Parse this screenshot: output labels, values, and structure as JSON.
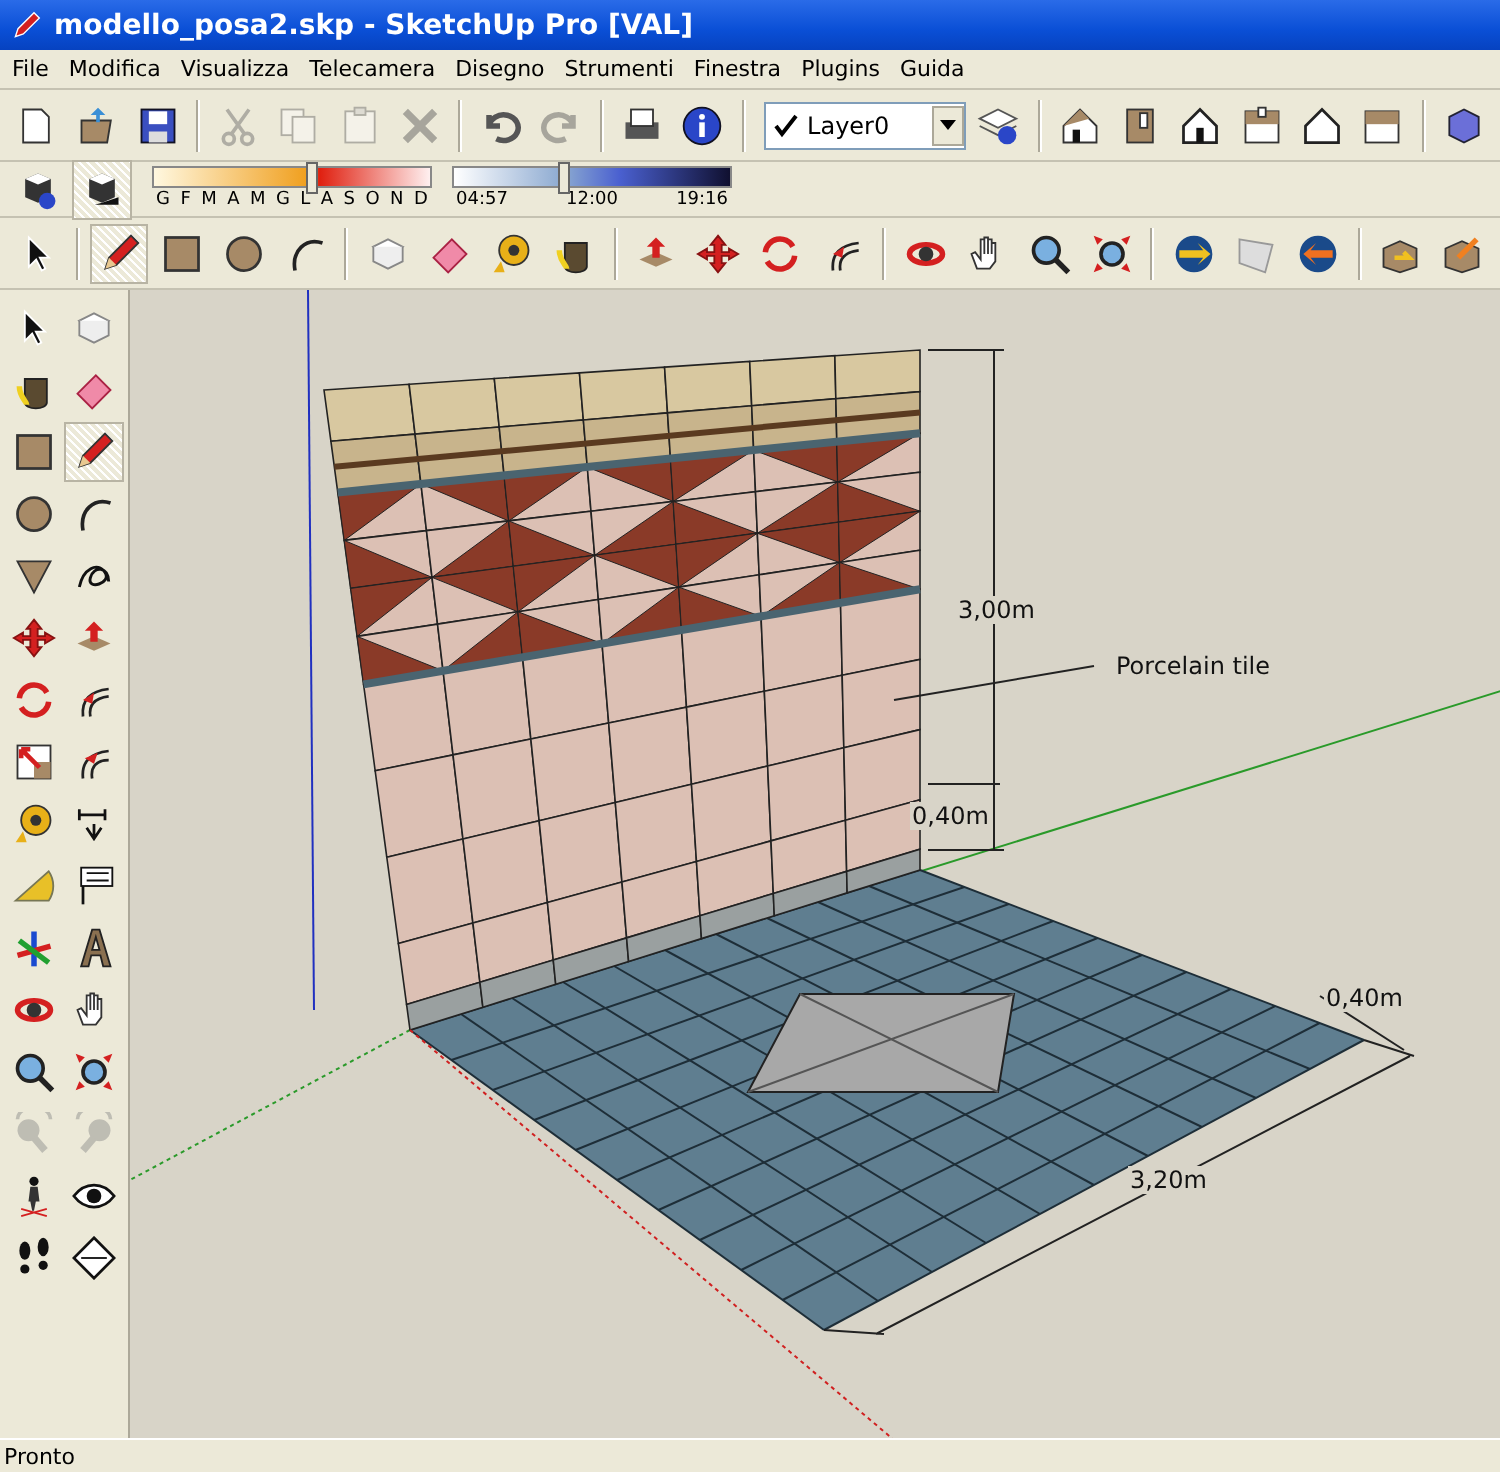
{
  "window": {
    "title": "modello_posa2.skp - SketchUp Pro [VAL]"
  },
  "menu": [
    "File",
    "Modifica",
    "Visualizza",
    "Telecamera",
    "Disegno",
    "Strumenti",
    "Finestra",
    "Plugins",
    "Guida"
  ],
  "standard_tools": [
    {
      "disabled": false
    },
    {
      "disabled": false
    },
    {
      "disabled": false
    },
    {
      "disabled": true
    },
    {
      "disabled": true
    },
    {
      "disabled": true
    },
    {
      "disabled": true
    },
    {
      "disabled": false
    },
    {
      "disabled": true
    },
    {
      "disabled": false
    },
    {
      "disabled": false
    }
  ],
  "layer": {
    "checked": true,
    "value": "Layer0"
  },
  "shadows": {
    "months": [
      "G",
      "F",
      "M",
      "A",
      "M",
      "G",
      "L",
      "A",
      "S",
      "O",
      "N",
      "D"
    ],
    "month_slider": {
      "level": 0.57
    },
    "time_start": "04:57",
    "time_mid": "12:00",
    "time_end": "19:16",
    "time_slider": {
      "level": 0.4
    }
  },
  "top_tools": [
    {
      "selected": false
    },
    {
      "selected": true
    },
    {
      "selected": false
    },
    {
      "selected": false
    },
    {
      "selected": false
    }
  ],
  "left_tools": [
    {
      "selected": false,
      "disabled": false
    },
    {
      "selected": false,
      "disabled": false
    },
    {
      "selected": false,
      "disabled": false
    },
    {
      "selected": false,
      "disabled": false
    },
    {
      "selected": false,
      "disabled": false
    },
    {
      "selected": true,
      "disabled": false
    },
    {
      "selected": false,
      "disabled": false
    },
    {
      "selected": false,
      "disabled": false
    },
    {
      "selected": false,
      "disabled": false
    },
    {
      "selected": false,
      "disabled": false
    },
    {
      "selected": false,
      "disabled": false
    },
    {
      "selected": false,
      "disabled": false
    },
    {
      "selected": false,
      "disabled": false
    },
    {
      "selected": false,
      "disabled": false
    },
    {
      "selected": false,
      "disabled": false
    },
    {
      "selected": false,
      "disabled": false
    },
    {
      "selected": false,
      "disabled": false
    },
    {
      "selected": false,
      "disabled": false
    },
    {
      "selected": false,
      "disabled": false
    },
    {
      "selected": false,
      "disabled": false
    },
    {
      "selected": false,
      "disabled": false
    },
    {
      "selected": false,
      "disabled": false
    },
    {
      "selected": false,
      "disabled": false
    },
    {
      "selected": false,
      "disabled": false
    },
    {
      "selected": false,
      "disabled": false
    },
    {
      "selected": false,
      "disabled": false
    },
    {
      "selected": false,
      "disabled": true
    },
    {
      "selected": false,
      "disabled": true
    },
    {
      "selected": false,
      "disabled": false
    },
    {
      "selected": false,
      "disabled": false
    },
    {
      "selected": false,
      "disabled": false
    },
    {
      "selected": false,
      "disabled": false
    }
  ],
  "viewport": {
    "labels": [
      "3,00m",
      "Porcelain tile",
      "0,40m",
      "0,40m",
      "3,20m"
    ]
  },
  "status_bar": {
    "text": "Pronto"
  }
}
